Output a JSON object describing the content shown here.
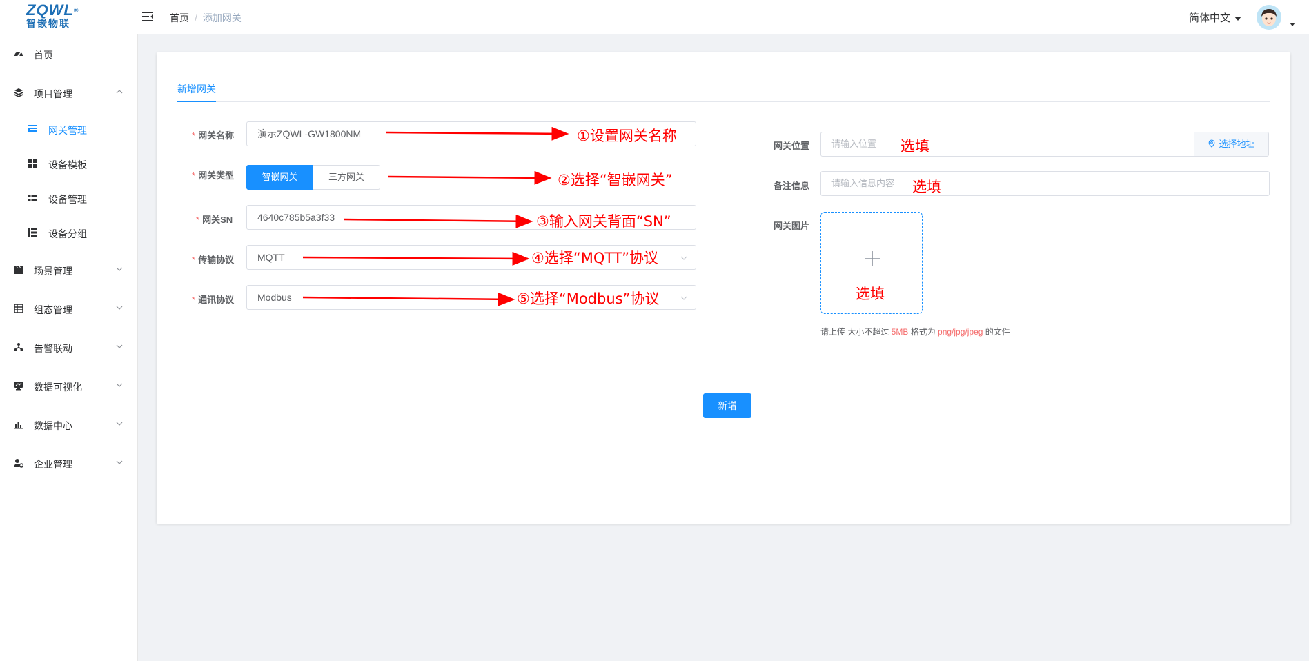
{
  "header": {
    "logo_text": "ZQWL",
    "logo_sub": "智嵌物联",
    "breadcrumb_home": "首页",
    "breadcrumb_sep": "/",
    "breadcrumb_current": "添加网关",
    "language": "简体中文"
  },
  "sidebar": {
    "items": [
      {
        "label": "首页",
        "icon": "dashboard-icon"
      },
      {
        "label": "项目管理",
        "icon": "layers-icon",
        "expanded": true
      },
      {
        "label": "网关管理",
        "icon": "gateway-list-icon",
        "sub": true,
        "active": true
      },
      {
        "label": "设备模板",
        "icon": "grid-icon",
        "sub": true
      },
      {
        "label": "设备管理",
        "icon": "server-icon",
        "sub": true
      },
      {
        "label": "设备分组",
        "icon": "group-icon",
        "sub": true
      },
      {
        "label": "场景管理",
        "icon": "clapper-icon"
      },
      {
        "label": "组态管理",
        "icon": "table-icon"
      },
      {
        "label": "告警联动",
        "icon": "network-icon"
      },
      {
        "label": "数据可视化",
        "icon": "monitor-icon"
      },
      {
        "label": "数据中心",
        "icon": "bar-chart-icon"
      },
      {
        "label": "企业管理",
        "icon": "user-gear-icon"
      }
    ]
  },
  "form": {
    "tab": "新增网关",
    "name_label": "网关名称",
    "name_value": "演示ZQWL-GW1800NM",
    "type_label": "网关类型",
    "type_options": [
      "智嵌网关",
      "三方网关"
    ],
    "sn_label": "网关SN",
    "sn_value": "4640c785b5a3f33",
    "protocol_label": "传输协议",
    "protocol_value": "MQTT",
    "comm_label": "通讯协议",
    "comm_value": "Modbus",
    "location_label": "网关位置",
    "location_placeholder": "请输入位置",
    "location_button": "选择地址",
    "remark_label": "备注信息",
    "remark_placeholder": "请输入信息内容",
    "image_label": "网关图片",
    "upload_tip_a": "请上传 大小不超过 ",
    "upload_tip_size": "5MB",
    "upload_tip_b": " 格式为 ",
    "upload_tip_fmt": "png/jpg/jpeg",
    "upload_tip_c": " 的文件",
    "submit": "新增"
  },
  "annotations": {
    "a1": "①设置网关名称",
    "a2": "②选择“智嵌网关”",
    "a3": "③输入网关背面“SN”",
    "a4": "④选择“MQTT”协议",
    "a5": "⑤选择“Modbus”协议",
    "fill1": "选填",
    "fill2": "选填",
    "fill3": "选填"
  },
  "colors": {
    "primary": "#1890ff",
    "annotation": "#ff0000",
    "required": "#f56c6c"
  }
}
